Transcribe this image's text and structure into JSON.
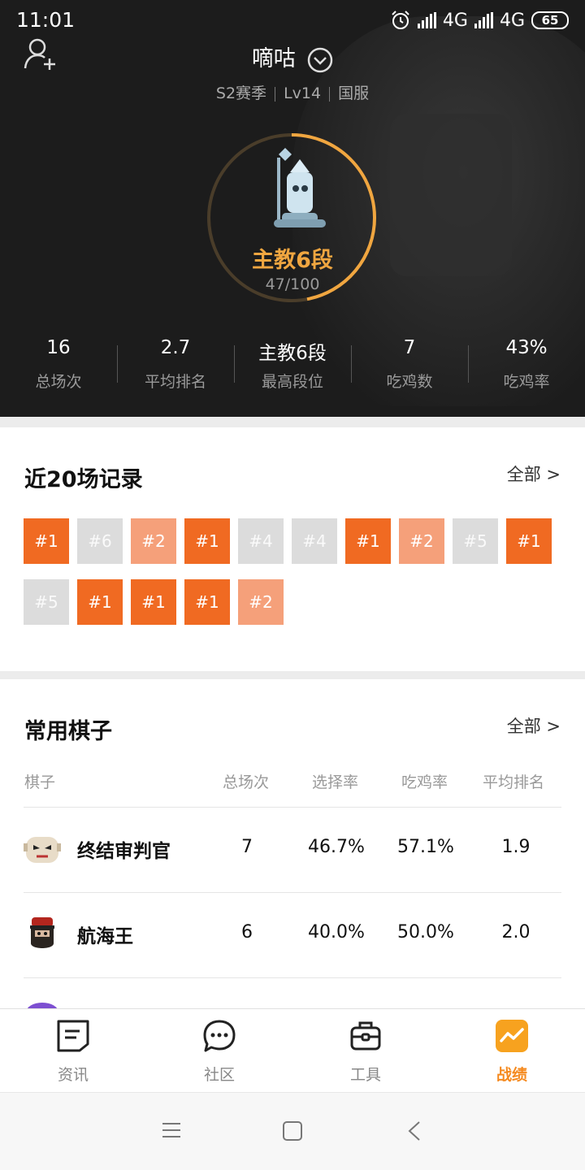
{
  "status": {
    "time": "11:01",
    "net1": "4G",
    "net2": "4G",
    "battery": "65"
  },
  "header": {
    "username": "嘀咕",
    "season": "S2赛季",
    "level": "Lv14",
    "server": "国服",
    "rank_name": "主教6段",
    "rank_progress": "47/100",
    "progress_fraction": 0.47,
    "accent_color": "#f0a640"
  },
  "stats": [
    {
      "value": "16",
      "label": "总场次"
    },
    {
      "value": "2.7",
      "label": "平均排名"
    },
    {
      "value": "主教6段",
      "label": "最高段位"
    },
    {
      "value": "7",
      "label": "吃鸡数"
    },
    {
      "value": "43%",
      "label": "吃鸡率"
    }
  ],
  "records": {
    "title": "近20场记录",
    "more": "全部 >",
    "items": [
      "#1",
      "#6",
      "#2",
      "#1",
      "#4",
      "#4",
      "#1",
      "#2",
      "#5",
      "#1",
      "#5",
      "#1",
      "#1",
      "#1",
      "#2"
    ],
    "colors": {
      "first": "#f06a22",
      "second": "#f5a07a",
      "other": "#dcdcdc"
    }
  },
  "pieces": {
    "title": "常用棋子",
    "more": "全部 >",
    "headers": [
      "棋子",
      "总场次",
      "选择率",
      "吃鸡率",
      "平均排名"
    ],
    "rows": [
      {
        "name": "终结审判官",
        "games": "7",
        "pick": "46.7%",
        "win": "57.1%",
        "avg": "1.9",
        "avatar": "skull-mask-avatar"
      },
      {
        "name": "航海王",
        "games": "6",
        "pick": "40.0%",
        "win": "50.0%",
        "avg": "2.0",
        "avatar": "pirate-avatar"
      }
    ]
  },
  "tabs": [
    {
      "label": "资讯",
      "icon": "news-icon"
    },
    {
      "label": "社区",
      "icon": "chat-bubble-icon"
    },
    {
      "label": "工具",
      "icon": "toolbox-icon"
    },
    {
      "label": "战绩",
      "icon": "chart-line-icon",
      "active": true
    }
  ]
}
